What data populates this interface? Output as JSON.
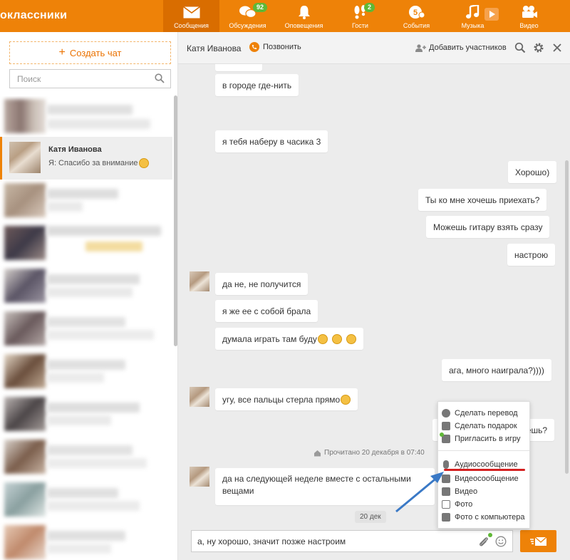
{
  "app": {
    "logo_text": "оклассники",
    "brand_color": "#ee8208"
  },
  "nav": [
    {
      "label": "Сообщения",
      "icon": "envelope-icon",
      "active": true,
      "badge": ""
    },
    {
      "label": "Обсуждения",
      "icon": "discussions-icon",
      "active": false,
      "badge": "92"
    },
    {
      "label": "Оповещения",
      "icon": "bell-icon",
      "active": false,
      "badge": ""
    },
    {
      "label": "Гости",
      "icon": "footprints-icon",
      "active": false,
      "badge": "2"
    },
    {
      "label": "События",
      "icon": "events-icon",
      "active": false,
      "badge": ""
    },
    {
      "label": "Музыка",
      "icon": "music-note-icon",
      "active": false,
      "badge": ""
    },
    {
      "label": "Видео",
      "icon": "video-camera-icon",
      "active": false,
      "badge": ""
    }
  ],
  "sidebar": {
    "create_chat_label": "Создать чат",
    "search_placeholder": "Поиск",
    "active_chat": {
      "name": "Катя Иванова",
      "preview": "Я: Спасибо за внимание"
    }
  },
  "chat": {
    "contact_name": "Катя Иванова",
    "call_label": "Позвонить",
    "add_participants_label": "Добавить участников",
    "messages": [
      {
        "side": "in",
        "text": "в городе где-нить"
      },
      {
        "side": "in",
        "text": "я тебя наберу в часика 3"
      },
      {
        "side": "out",
        "text": "Хорошо)"
      },
      {
        "side": "out",
        "text": "Ты ко мне хочешь приехать?"
      },
      {
        "side": "out",
        "text": "Можешь гитару взять сразу"
      },
      {
        "side": "out",
        "text": "настрою"
      },
      {
        "side": "in",
        "text": "да не, не получится"
      },
      {
        "side": "in",
        "text": "я же ее с собой брала"
      },
      {
        "side": "in",
        "text": "думала играть там буду"
      },
      {
        "side": "out",
        "text": "ага, много наиграла?))))"
      },
      {
        "side": "in",
        "text": "угу, все пальцы стерла прямо"
      },
      {
        "side": "out",
        "text": "когда назад то привезешь?"
      },
      {
        "side": "in",
        "text": "да на следующей неделе вместе с остальными вещами"
      }
    ],
    "read_status": "Прочитано 20 декабря в 07:40",
    "date_separator": "20 дек",
    "composer_value": "а, ну хорошо, значит позже настроим"
  },
  "attach_menu": [
    {
      "label": "Сделать перевод",
      "icon": "money-transfer-icon"
    },
    {
      "label": "Сделать подарок",
      "icon": "gift-icon"
    },
    {
      "label": "Пригласить в игру",
      "icon": "gamepad-icon"
    },
    {
      "label": "Аудиосообщение",
      "icon": "microphone-icon"
    },
    {
      "label": "Видеосообщение",
      "icon": "video-message-icon"
    },
    {
      "label": "Видео",
      "icon": "video-icon"
    },
    {
      "label": "Фото",
      "icon": "photo-icon"
    },
    {
      "label": "Фото с компьютера",
      "icon": "camera-icon"
    }
  ]
}
